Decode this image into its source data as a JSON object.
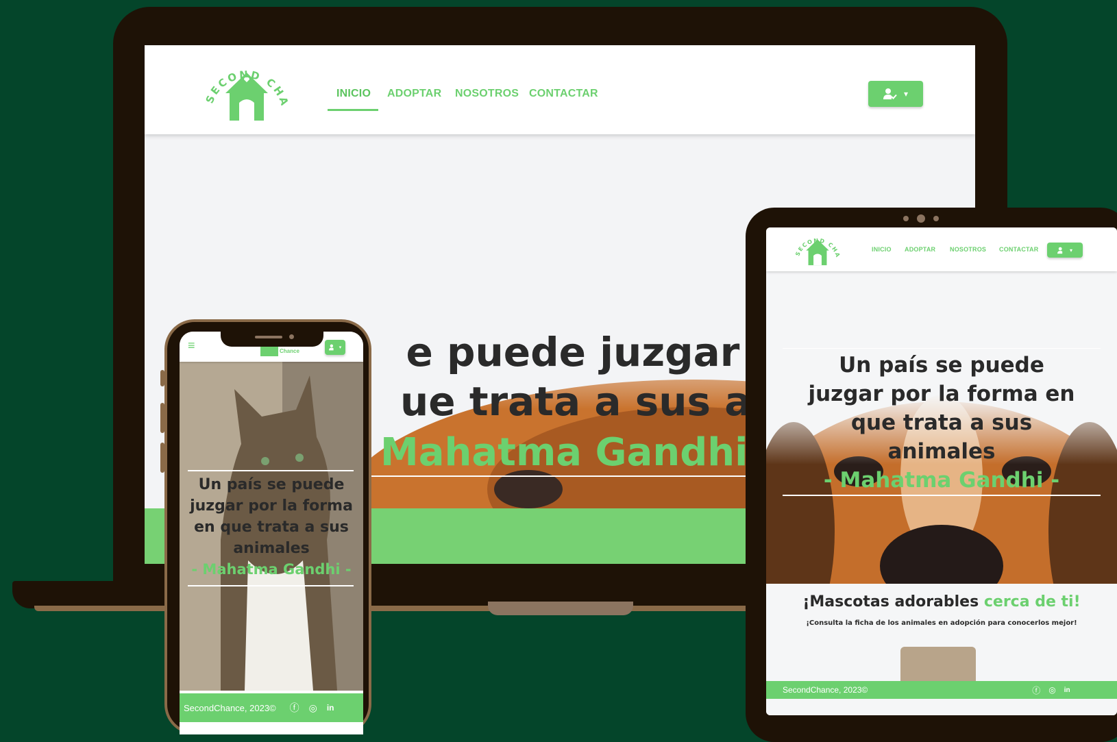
{
  "brand": {
    "logo_top": "SECOND CHANCE",
    "logo_short": "Chance",
    "accent": "#6cd06f",
    "background": "#04452a",
    "device_frame": "#1e1206"
  },
  "nav": {
    "items": [
      "INICIO",
      "ADOPTAR",
      "NOSOTROS",
      "CONTACTAR"
    ],
    "active": "INICIO",
    "user_icon": "user-check-icon",
    "caret": "▾",
    "menu_icon": "≡"
  },
  "hero": {
    "laptop_line1": "e puede juzgar por",
    "laptop_line2": "ue trata a sus anim",
    "laptop_author": "Mahatma Gandhi -",
    "phone_quote": [
      "Un país se puede",
      "juzgar por la forma",
      "en que trata a sus",
      "animales"
    ],
    "tablet_quote": [
      "Un país se puede",
      "juzgar por la forma en",
      "que trata a sus",
      "animales"
    ],
    "author": "- Mahatma Gandhi -"
  },
  "pets_section": {
    "title_plain": "¡Mascotas adorables ",
    "title_accent": "cerca de ti!",
    "subtitle": "¡Consulta la ficha de los animales en adopción para conocerlos mejor!"
  },
  "footer": {
    "copyright": "SecondChance, 2023©",
    "social": [
      "facebook-icon",
      "instagram-icon",
      "linkedin-icon"
    ]
  }
}
